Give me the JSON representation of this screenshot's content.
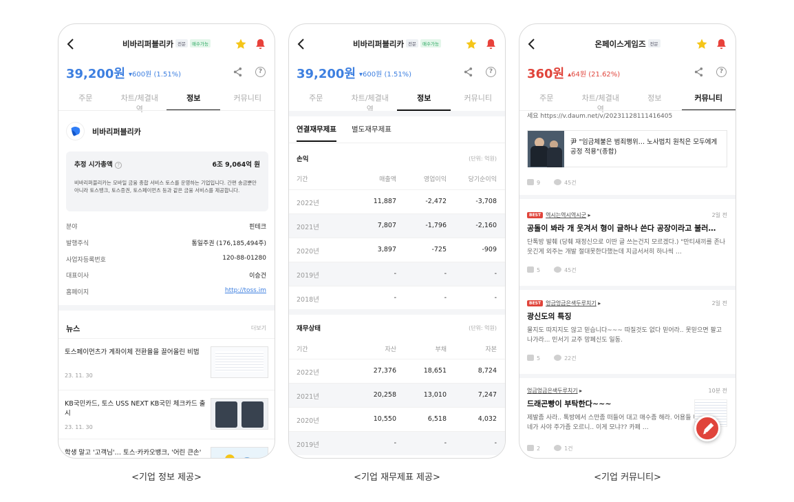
{
  "screens": [
    {
      "title": "비바리퍼블리카",
      "badges": [
        "전문",
        "매수가능"
      ],
      "price": "39,200원",
      "change": "▾600원 (1.51%)",
      "tabs": [
        "주문",
        "차트/체결내역",
        "정보",
        "커뮤니티"
      ],
      "active_tab": "정보",
      "company_name": "비바리퍼블리카",
      "market_cap_label": "추정 시가총액",
      "market_cap_value": "6조 9,064억 원",
      "description": "비바리퍼블리카는 모바일 금융 종합 서비스 토스를 운영하는 기업입니다. 간편 송금뿐만 아니라 토스뱅크, 토스증권, 토스페이먼츠 등과 같은 금융 서비스를 제공합니다.",
      "details": [
        {
          "label": "분야",
          "value": "핀테크"
        },
        {
          "label": "발행주식",
          "value": "통일주권 (176,185,494주)"
        },
        {
          "label": "사업자등록번호",
          "value": "120-88-01280"
        },
        {
          "label": "대표이사",
          "value": "이승건"
        },
        {
          "label": "홈페이지",
          "value": "http://toss.im"
        }
      ],
      "news_header": "뉴스",
      "news_more": "더보기",
      "news": [
        {
          "title": "토스페이먼츠가 계좌이체 전환율을 끌어올린 비법",
          "date": "23. 11. 30"
        },
        {
          "title": "KB국민카드, 토스 USS NEXT KB국민 체크카드 출시",
          "date": "23. 11. 30"
        },
        {
          "title": "학생 말고 '고객님'… 토스·카카오뱅크, '어린 큰손' 모시기 혈전",
          "date": ""
        }
      ],
      "caption": "<기업 정보 제공>"
    },
    {
      "title": "비바리퍼블리카",
      "badges": [
        "전문",
        "매수가능"
      ],
      "price": "39,200원",
      "change": "▾600원 (1.51%)",
      "tabs": [
        "주문",
        "차트/체결내역",
        "정보",
        "커뮤니티"
      ],
      "active_tab": "정보",
      "sub_tabs": [
        "연결재무제표",
        "별도재무제표"
      ],
      "income": {
        "title": "손익",
        "unit": "(단위: 억원)",
        "headers": [
          "기간",
          "매출액",
          "영업이익",
          "당기순이익"
        ],
        "rows": [
          [
            "2022년",
            "11,887",
            "-2,472",
            "-3,708"
          ],
          [
            "2021년",
            "7,807",
            "-1,796",
            "-2,160"
          ],
          [
            "2020년",
            "3,897",
            "-725",
            "-909"
          ],
          [
            "2019년",
            "-",
            "-",
            "-"
          ],
          [
            "2018년",
            "-",
            "-",
            "-"
          ]
        ]
      },
      "balance": {
        "title": "재무상태",
        "unit": "(단위: 억원)",
        "headers": [
          "기간",
          "자산",
          "부채",
          "자본"
        ],
        "rows": [
          [
            "2022년",
            "27,376",
            "18,651",
            "8,724"
          ],
          [
            "2021년",
            "20,258",
            "13,010",
            "7,247"
          ],
          [
            "2020년",
            "10,550",
            "6,518",
            "4,032"
          ],
          [
            "2019년",
            "-",
            "-",
            "-"
          ]
        ]
      },
      "caption": "<기업 재무제표 제공>"
    },
    {
      "title": "온페이스게임즈",
      "badges": [
        "전문"
      ],
      "price": "360원",
      "change": "▴64원 (21.62%)",
      "tabs": [
        "주문",
        "차트/체결내역",
        "정보",
        "커뮤니티"
      ],
      "active_tab": "커뮤니티",
      "top_text": "세요 https://v.daum.net/v/20231128111416405",
      "link_card": "尹 \"임금체불은 범죄행위… 노사법치 원칙은 모두에게 공정 적용\"(종합)",
      "top_likes": "9",
      "top_comments": "45건",
      "posts": [
        {
          "best": "BEST",
          "author": "역시는역시역시군",
          "time": "2일 전",
          "title": "공돌이 봐라 개 웃겨서 형이 글하나 쓴다 공장이라고 불러…",
          "body": "단톡방 발췌 (당췌 재정신으로 이딴 글 쓰는건지 모르겠다.) \"만티새끼를 존나웃긴게 외주는 개발 절대못한다했는데 지금서서히 하나씩 …",
          "likes": "5",
          "comments": "45건"
        },
        {
          "best": "BEST",
          "author": "엉금엉금은색두루치기",
          "time": "2일 전",
          "title": "광신도의 특징",
          "body": "물지도 따지지도 않고 믿습니다~~~ 따질것도 없다 믿어라.. 못믿으면 팔고 나가라... 민서기 교주 망폐신도 일동.",
          "likes": "5",
          "comments": "22건"
        },
        {
          "best": "",
          "author": "엉금엉금은색두루치기",
          "time": "10분 전",
          "title": "드래곤빵이 부탁한다~~~",
          "body": "제발좀 사라.. 톡방에서 스만좀 떠들어 대고 매수좀 해라. 어용들 니네가 사야 주가좀 오르니.. 이게 모냐?? 카페 …",
          "likes": "2",
          "comments": "1건"
        }
      ],
      "caption": "<기업 커뮤니티>"
    }
  ],
  "colors": {
    "up": "#e0443b",
    "down": "#3d7fe0",
    "star": "#f5c518",
    "bell": "#e8413a"
  }
}
